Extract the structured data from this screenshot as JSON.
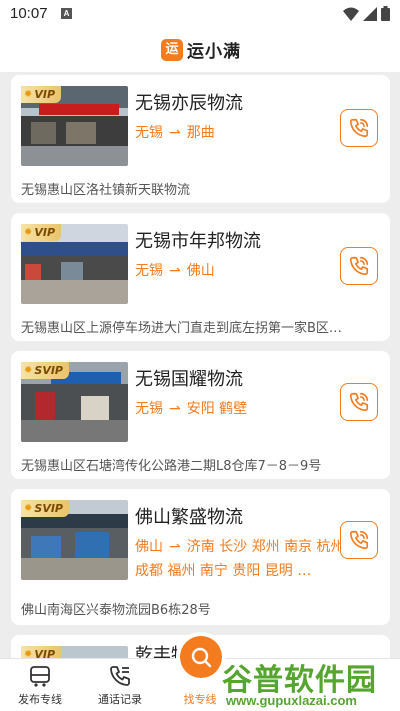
{
  "status_bar": {
    "time": "10:07",
    "a_badge": "A"
  },
  "header": {
    "logo_char": "运",
    "title": "运小满"
  },
  "cards": [
    {
      "badge": "VIP",
      "name": "无锡亦辰物流",
      "route_from": "无锡",
      "route_to": "那曲",
      "address": "无锡惠山区洛社镇新天联物流"
    },
    {
      "badge": "VIP",
      "name": "无锡市年邦物流",
      "route_from": "无锡",
      "route_to": "佛山",
      "address": "无锡惠山区上源停车场进大门直走到底左拐第一家B区…"
    },
    {
      "badge": "SVIP",
      "name": "无锡国耀物流",
      "route_from": "无锡",
      "route_to": "安阳 鹤壁",
      "address": "无锡惠山区石塘湾传化公路港二期L8仓库7－8－9号"
    },
    {
      "badge": "SVIP",
      "name": "佛山繁盛物流",
      "route_from": "佛山",
      "route_to": "济南 长沙 郑州 南京 杭州 成都 福州 南宁 贵阳 昆明 …",
      "address": "佛山南海区兴泰物流园B6栋28号"
    },
    {
      "badge": "VIP",
      "name": "乾丰物流",
      "route_from": "",
      "route_to": "",
      "address": ""
    }
  ],
  "bottom_nav": {
    "items": [
      {
        "label": "发布专线",
        "icon": "truck-icon"
      },
      {
        "label": "通话记录",
        "icon": "phone-log-icon"
      },
      {
        "label": "找专线",
        "icon": "search-icon"
      }
    ]
  },
  "watermark": {
    "main": "谷普软件园",
    "url": "www.gupuxlazai.com"
  },
  "colors": {
    "accent": "#f57b1f",
    "watermark": "#55a52f"
  }
}
